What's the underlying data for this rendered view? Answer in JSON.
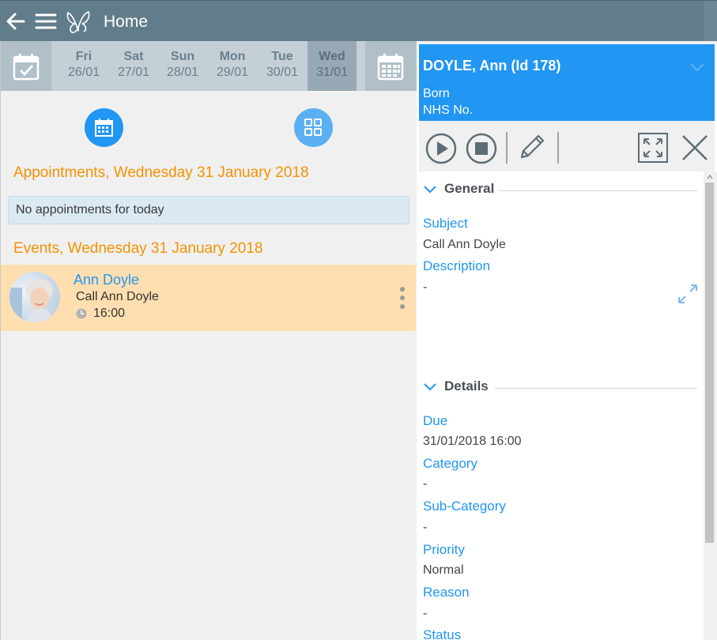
{
  "app": {
    "title": "Home"
  },
  "date_strip": {
    "days": [
      {
        "name": "Fri",
        "date": "26/01"
      },
      {
        "name": "Sat",
        "date": "27/01"
      },
      {
        "name": "Sun",
        "date": "28/01"
      },
      {
        "name": "Mon",
        "date": "29/01"
      },
      {
        "name": "Tue",
        "date": "30/01"
      },
      {
        "name": "Wed",
        "date": "31/01"
      }
    ],
    "selected_day": "Wed"
  },
  "appointments": {
    "title": "Appointments, Wednesday 31 January 2018",
    "empty_message": "No appointments for today"
  },
  "events": {
    "title": "Events, Wednesday 31 January 2018",
    "items": [
      {
        "name": "Ann Doyle",
        "subject": "Call Ann Doyle",
        "time": "16:00"
      }
    ]
  },
  "patient": {
    "header": "DOYLE, Ann (Id 178)",
    "born_label": "Born",
    "nhs_label": "NHS No."
  },
  "detail": {
    "general": {
      "title": "General",
      "subject_label": "Subject",
      "subject_value": "Call Ann Doyle",
      "description_label": "Description",
      "description_value": "-"
    },
    "details": {
      "title": "Details",
      "due_label": "Due",
      "due_value": "31/01/2018 16:00",
      "category_label": "Category",
      "category_value": "-",
      "subcategory_label": "Sub-Category",
      "subcategory_value": "-",
      "priority_label": "Priority",
      "priority_value": "Normal",
      "reason_label": "Reason",
      "reason_value": "-",
      "status_label": "Status"
    }
  },
  "colors": {
    "topbar": "#617d8b",
    "accent_blue": "#2196f3",
    "accent_orange": "#f39200",
    "event_bg": "#ffdfb0"
  },
  "icons": [
    "back-arrow-icon",
    "hamburger-menu-icon",
    "butterfly-logo-icon",
    "calendar-check-icon",
    "calendar-grid-icon",
    "calendar-day-icon",
    "grid-view-icon",
    "clock-icon",
    "more-vertical-icon",
    "chevron-down-icon",
    "play-icon",
    "stop-icon",
    "pencil-icon",
    "fullscreen-icon",
    "close-icon",
    "expand-arrows-icon"
  ]
}
